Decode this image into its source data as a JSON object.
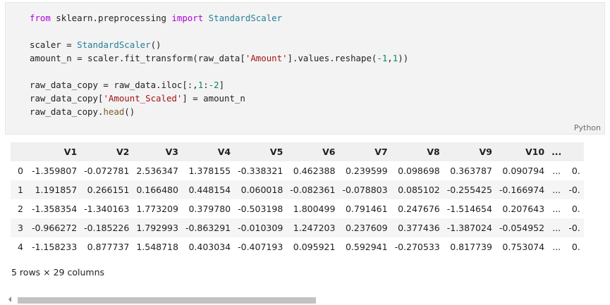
{
  "code_cell": {
    "language": "Python",
    "lines": [
      [
        {
          "t": "kw",
          "v": "from"
        },
        {
          "t": "",
          "v": " sklearn.preprocessing "
        },
        {
          "t": "kw",
          "v": "import"
        },
        {
          "t": "",
          "v": " "
        },
        {
          "t": "cls",
          "v": "StandardScaler"
        }
      ],
      [],
      [
        {
          "t": "",
          "v": "scaler = "
        },
        {
          "t": "cls",
          "v": "StandardScaler"
        },
        {
          "t": "",
          "v": "()"
        }
      ],
      [
        {
          "t": "",
          "v": "amount_n = scaler.fit_transform(raw_data["
        },
        {
          "t": "str",
          "v": "'Amount'"
        },
        {
          "t": "",
          "v": "].values.reshape("
        },
        {
          "t": "num",
          "v": "-1"
        },
        {
          "t": "",
          "v": ","
        },
        {
          "t": "num",
          "v": "1"
        },
        {
          "t": "",
          "v": "))"
        }
      ],
      [],
      [
        {
          "t": "",
          "v": "raw_data_copy = raw_data.iloc[:,"
        },
        {
          "t": "num",
          "v": "1"
        },
        {
          "t": "",
          "v": ":"
        },
        {
          "t": "num",
          "v": "-2"
        },
        {
          "t": "",
          "v": "]"
        }
      ],
      [
        {
          "t": "",
          "v": "raw_data_copy["
        },
        {
          "t": "str",
          "v": "'Amount_Scaled'"
        },
        {
          "t": "",
          "v": "] = amount_n"
        }
      ],
      [
        {
          "t": "",
          "v": "raw_data_copy."
        },
        {
          "t": "fn",
          "v": "head"
        },
        {
          "t": "",
          "v": "()"
        }
      ]
    ]
  },
  "output_table": {
    "columns": [
      "V1",
      "V2",
      "V3",
      "V4",
      "V5",
      "V6",
      "V7",
      "V8",
      "V9",
      "V10",
      "...",
      ""
    ],
    "rows": [
      {
        "index": "0",
        "cells": [
          "-1.359807",
          "-0.072781",
          "2.536347",
          "1.378155",
          "-0.338321",
          "0.462388",
          "0.239599",
          "0.098698",
          "0.363787",
          "0.090794",
          "...",
          "0."
        ]
      },
      {
        "index": "1",
        "cells": [
          "1.191857",
          "0.266151",
          "0.166480",
          "0.448154",
          "0.060018",
          "-0.082361",
          "-0.078803",
          "0.085102",
          "-0.255425",
          "-0.166974",
          "...",
          "-0."
        ]
      },
      {
        "index": "2",
        "cells": [
          "-1.358354",
          "-1.340163",
          "1.773209",
          "0.379780",
          "-0.503198",
          "1.800499",
          "0.791461",
          "0.247676",
          "-1.514654",
          "0.207643",
          "...",
          "0."
        ]
      },
      {
        "index": "3",
        "cells": [
          "-0.966272",
          "-0.185226",
          "1.792993",
          "-0.863291",
          "-0.010309",
          "1.247203",
          "0.237609",
          "0.377436",
          "-1.387024",
          "-0.054952",
          "...",
          "-0."
        ]
      },
      {
        "index": "4",
        "cells": [
          "-1.158233",
          "0.877737",
          "1.548718",
          "0.403034",
          "-0.407193",
          "0.095921",
          "0.592941",
          "-0.270533",
          "0.817739",
          "0.753074",
          "...",
          "0."
        ]
      }
    ],
    "shape_caption": "5 rows × 29 columns"
  },
  "horizontal_scrollbar": {
    "scroll_fraction": 0.0,
    "visible_fraction": 0.5
  }
}
